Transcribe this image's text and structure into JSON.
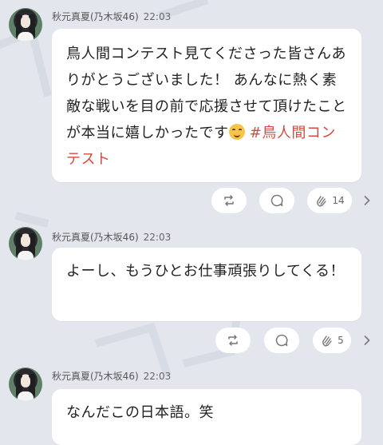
{
  "colors": {
    "background": "#e3e6ec",
    "bubble": "#ffffff",
    "hashtag": "#d24b3f",
    "text": "#222222",
    "meta": "#555555"
  },
  "posts": [
    {
      "author": "秋元真夏(乃木坂46)",
      "time": "22:03",
      "message": "鳥人間コンテスト見てくださった皆さんありがとうございました！ あんなに熱く素敵な戦いを目の前で応援させて頂けたことが本当に嬉しかったです",
      "emoji": "smiling-face",
      "hashtag": "#鳥人間コンテスト",
      "actions": {
        "repost_icon": "repost-icon",
        "comment_icon": "comment-icon",
        "clap_icon": "clap-icon",
        "clap_count": "14"
      }
    },
    {
      "author": "秋元真夏(乃木坂46)",
      "time": "22:03",
      "message": "よーし、もうひとお仕事頑張りしてくる！",
      "actions": {
        "repost_icon": "repost-icon",
        "comment_icon": "comment-icon",
        "clap_icon": "clap-icon",
        "clap_count": "5"
      }
    },
    {
      "author": "秋元真夏(乃木坂46)",
      "time": "22:03",
      "message": "なんだこの日本語。笑"
    }
  ]
}
